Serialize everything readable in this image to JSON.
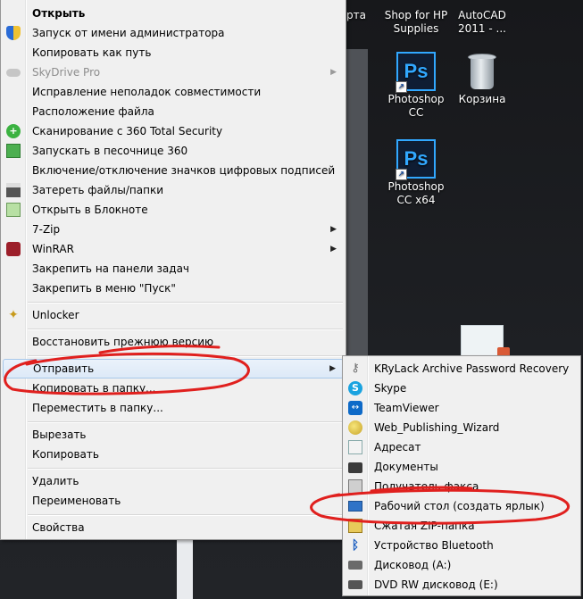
{
  "desktop": {
    "icons": [
      {
        "label": "арта"
      },
      {
        "label": "Shop for HP Supplies"
      },
      {
        "label": "AutoCAD 2011 - ..."
      },
      {
        "label": "Photoshop CC",
        "glyph": "Ps"
      },
      {
        "label": "Корзина"
      },
      {
        "label": "Photoshop CC x64",
        "glyph": "Ps"
      }
    ]
  },
  "context_menu": {
    "items": [
      {
        "label": "Открыть",
        "icon": "none"
      },
      {
        "label": "Запуск от имени администратора",
        "icon": "shield-icon"
      },
      {
        "label": "Копировать как путь",
        "icon": "none"
      },
      {
        "label": "SkyDrive Pro",
        "icon": "cloud-icon"
      },
      {
        "label": "Исправление неполадок совместимости",
        "icon": "none"
      },
      {
        "label": "Расположение файла",
        "icon": "none"
      },
      {
        "label": "Сканирование с 360 Total Security",
        "icon": "360-icon"
      },
      {
        "label": "Запускать в песочнице 360",
        "icon": "sandbox-icon"
      },
      {
        "label": "Включение/отключение значков цифровых подписей",
        "icon": "none"
      },
      {
        "label": "Затереть файлы/папки",
        "icon": "shredder-icon"
      },
      {
        "label": "Открыть в Блокноте",
        "icon": "notepad-icon"
      },
      {
        "label": "7-Zip",
        "icon": "none"
      },
      {
        "label": "WinRAR",
        "icon": "winrar-icon"
      },
      {
        "label": "Закрепить на панели задач",
        "icon": "none"
      },
      {
        "label": "Закрепить в меню \"Пуск\"",
        "icon": "none"
      },
      {
        "label": "Unlocker",
        "icon": "wand-icon"
      },
      {
        "label": "Восстановить прежнюю версию",
        "icon": "none"
      },
      {
        "label": "Отправить",
        "icon": "none"
      },
      {
        "label": "Копировать в папку...",
        "icon": "none"
      },
      {
        "label": "Переместить в папку...",
        "icon": "none"
      },
      {
        "label": "Вырезать",
        "icon": "none"
      },
      {
        "label": "Копировать",
        "icon": "none"
      },
      {
        "label": "Удалить",
        "icon": "none"
      },
      {
        "label": "Переименовать",
        "icon": "none"
      },
      {
        "label": "Свойства",
        "icon": "none"
      }
    ],
    "submenu_arrow": "▶"
  },
  "send_to_menu": {
    "items": [
      {
        "label": "KRyLack Archive Password Recovery",
        "icon": "key-icon"
      },
      {
        "label": "Skype",
        "icon": "skype-icon"
      },
      {
        "label": "TeamViewer",
        "icon": "teamviewer-icon"
      },
      {
        "label": "Web_Publishing_Wizard",
        "icon": "globe-icon"
      },
      {
        "label": "Адресат",
        "icon": "contact-icon"
      },
      {
        "label": "Документы",
        "icon": "documents-icon"
      },
      {
        "label": "Получатель факса",
        "icon": "fax-icon"
      },
      {
        "label": "Рабочий стол (создать ярлык)",
        "icon": "desktop-icon"
      },
      {
        "label": "Сжатая ZIP-папка",
        "icon": "zip-icon"
      },
      {
        "label": "Устройство Bluetooth",
        "icon": "bluetooth-icon"
      },
      {
        "label": "Дисковод (A:)",
        "icon": "floppy-icon"
      },
      {
        "label": "DVD RW дисковод (E:)",
        "icon": "dvd-icon"
      }
    ]
  },
  "colors": {
    "annotation": "#e0201e",
    "menu_bg": "#f0f0f0",
    "highlight": "#dde9f7"
  }
}
